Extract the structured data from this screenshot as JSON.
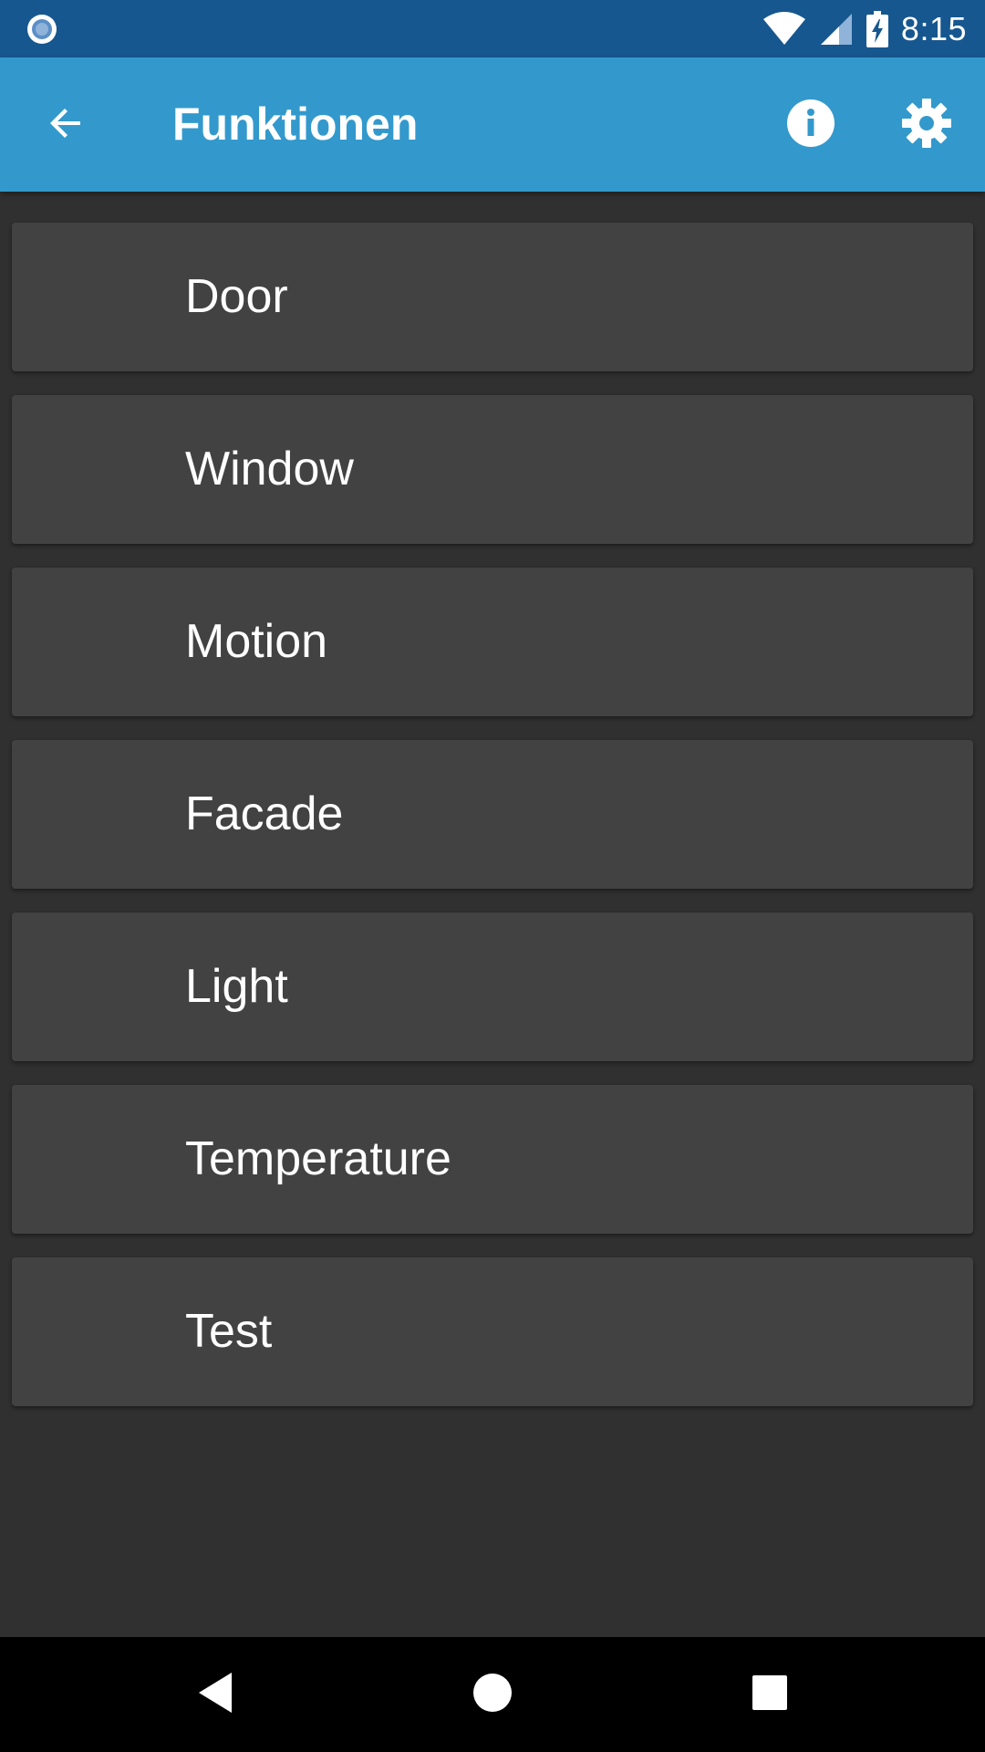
{
  "status_bar": {
    "time": "8:15",
    "icons": [
      "notification-icon",
      "wifi-icon",
      "signal-icon",
      "battery-charging-icon"
    ]
  },
  "app_bar": {
    "title": "Funktionen",
    "color": "#3399cc",
    "back_icon": "arrow-back-icon",
    "info_icon": "info-icon",
    "settings_icon": "gear-icon"
  },
  "functions": [
    {
      "label": "Door"
    },
    {
      "label": "Window"
    },
    {
      "label": "Motion"
    },
    {
      "label": "Facade"
    },
    {
      "label": "Light"
    },
    {
      "label": "Temperature"
    },
    {
      "label": "Test"
    }
  ],
  "nav_bar": {
    "buttons": [
      "nav-back-icon",
      "nav-home-icon",
      "nav-recents-icon"
    ]
  },
  "colors": {
    "status_bar": "#17578f",
    "background": "#303030",
    "card": "#424242",
    "text": "#ffffff"
  }
}
